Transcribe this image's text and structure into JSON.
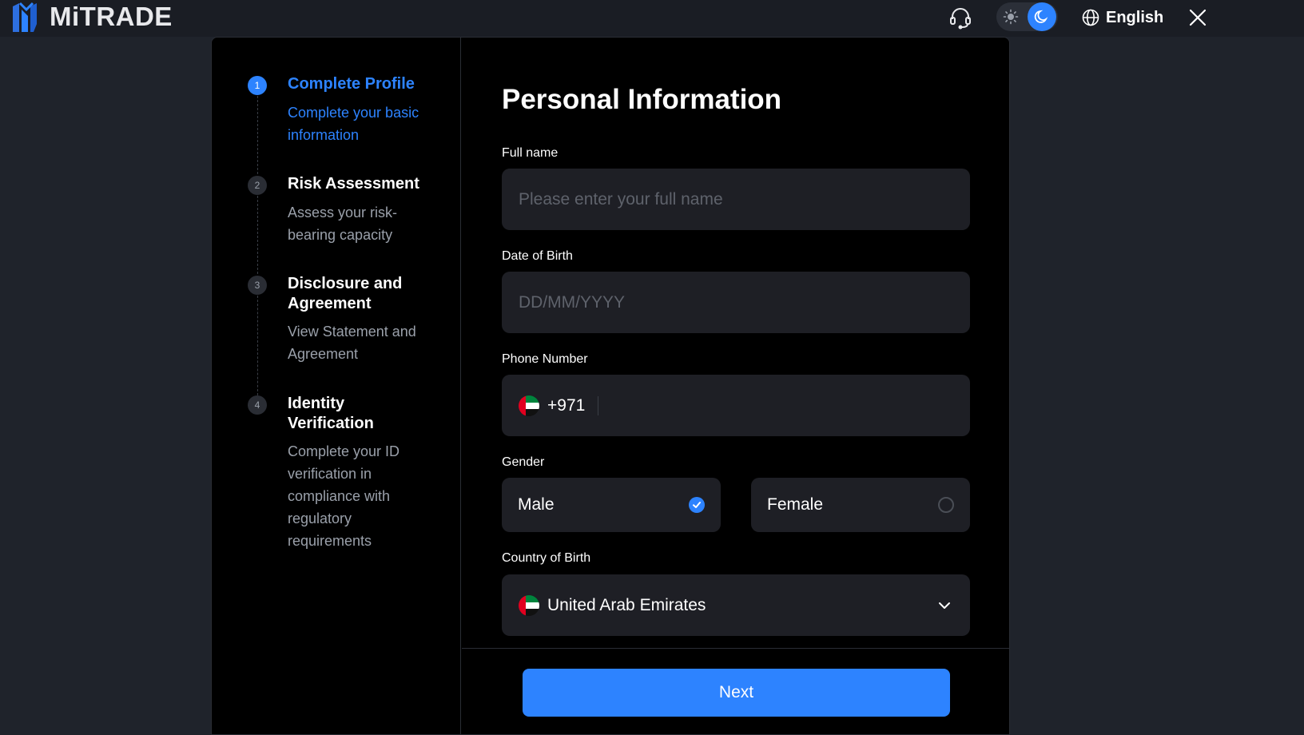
{
  "brand": {
    "name": "MiTRADE",
    "accent_color": "#2d83ff"
  },
  "header": {
    "support_icon": "headset-icon",
    "theme": {
      "light_icon": "sun-icon",
      "dark_icon": "moon-icon",
      "selected": "dark"
    },
    "language": {
      "icon": "globe-icon",
      "label": "English"
    },
    "close_icon": "close-icon"
  },
  "steps": [
    {
      "number": "1",
      "title": "Complete Profile",
      "desc": "Complete your basic information",
      "active": true
    },
    {
      "number": "2",
      "title": "Risk Assessment",
      "desc": "Assess your risk-bearing capacity",
      "active": false
    },
    {
      "number": "3",
      "title": "Disclosure and Agreement",
      "desc": "View Statement and Agreement",
      "active": false
    },
    {
      "number": "4",
      "title": "Identity Verification",
      "desc": "Complete your ID verification in compliance with regulatory requirements",
      "active": false
    }
  ],
  "form": {
    "title": "Personal Information",
    "full_name": {
      "label": "Full name",
      "placeholder": "Please enter your full name",
      "value": ""
    },
    "dob": {
      "label": "Date of Birth",
      "placeholder": "DD/MM/YYYY",
      "value": ""
    },
    "phone": {
      "label": "Phone Number",
      "code": "+971",
      "flag": "uae-flag-icon",
      "value": ""
    },
    "gender": {
      "label": "Gender",
      "options": [
        "Male",
        "Female"
      ],
      "selected": "Male"
    },
    "country": {
      "label": "Country of Birth",
      "value": "United Arab Emirates",
      "flag": "uae-flag-icon"
    }
  },
  "footer": {
    "next_label": "Next"
  }
}
